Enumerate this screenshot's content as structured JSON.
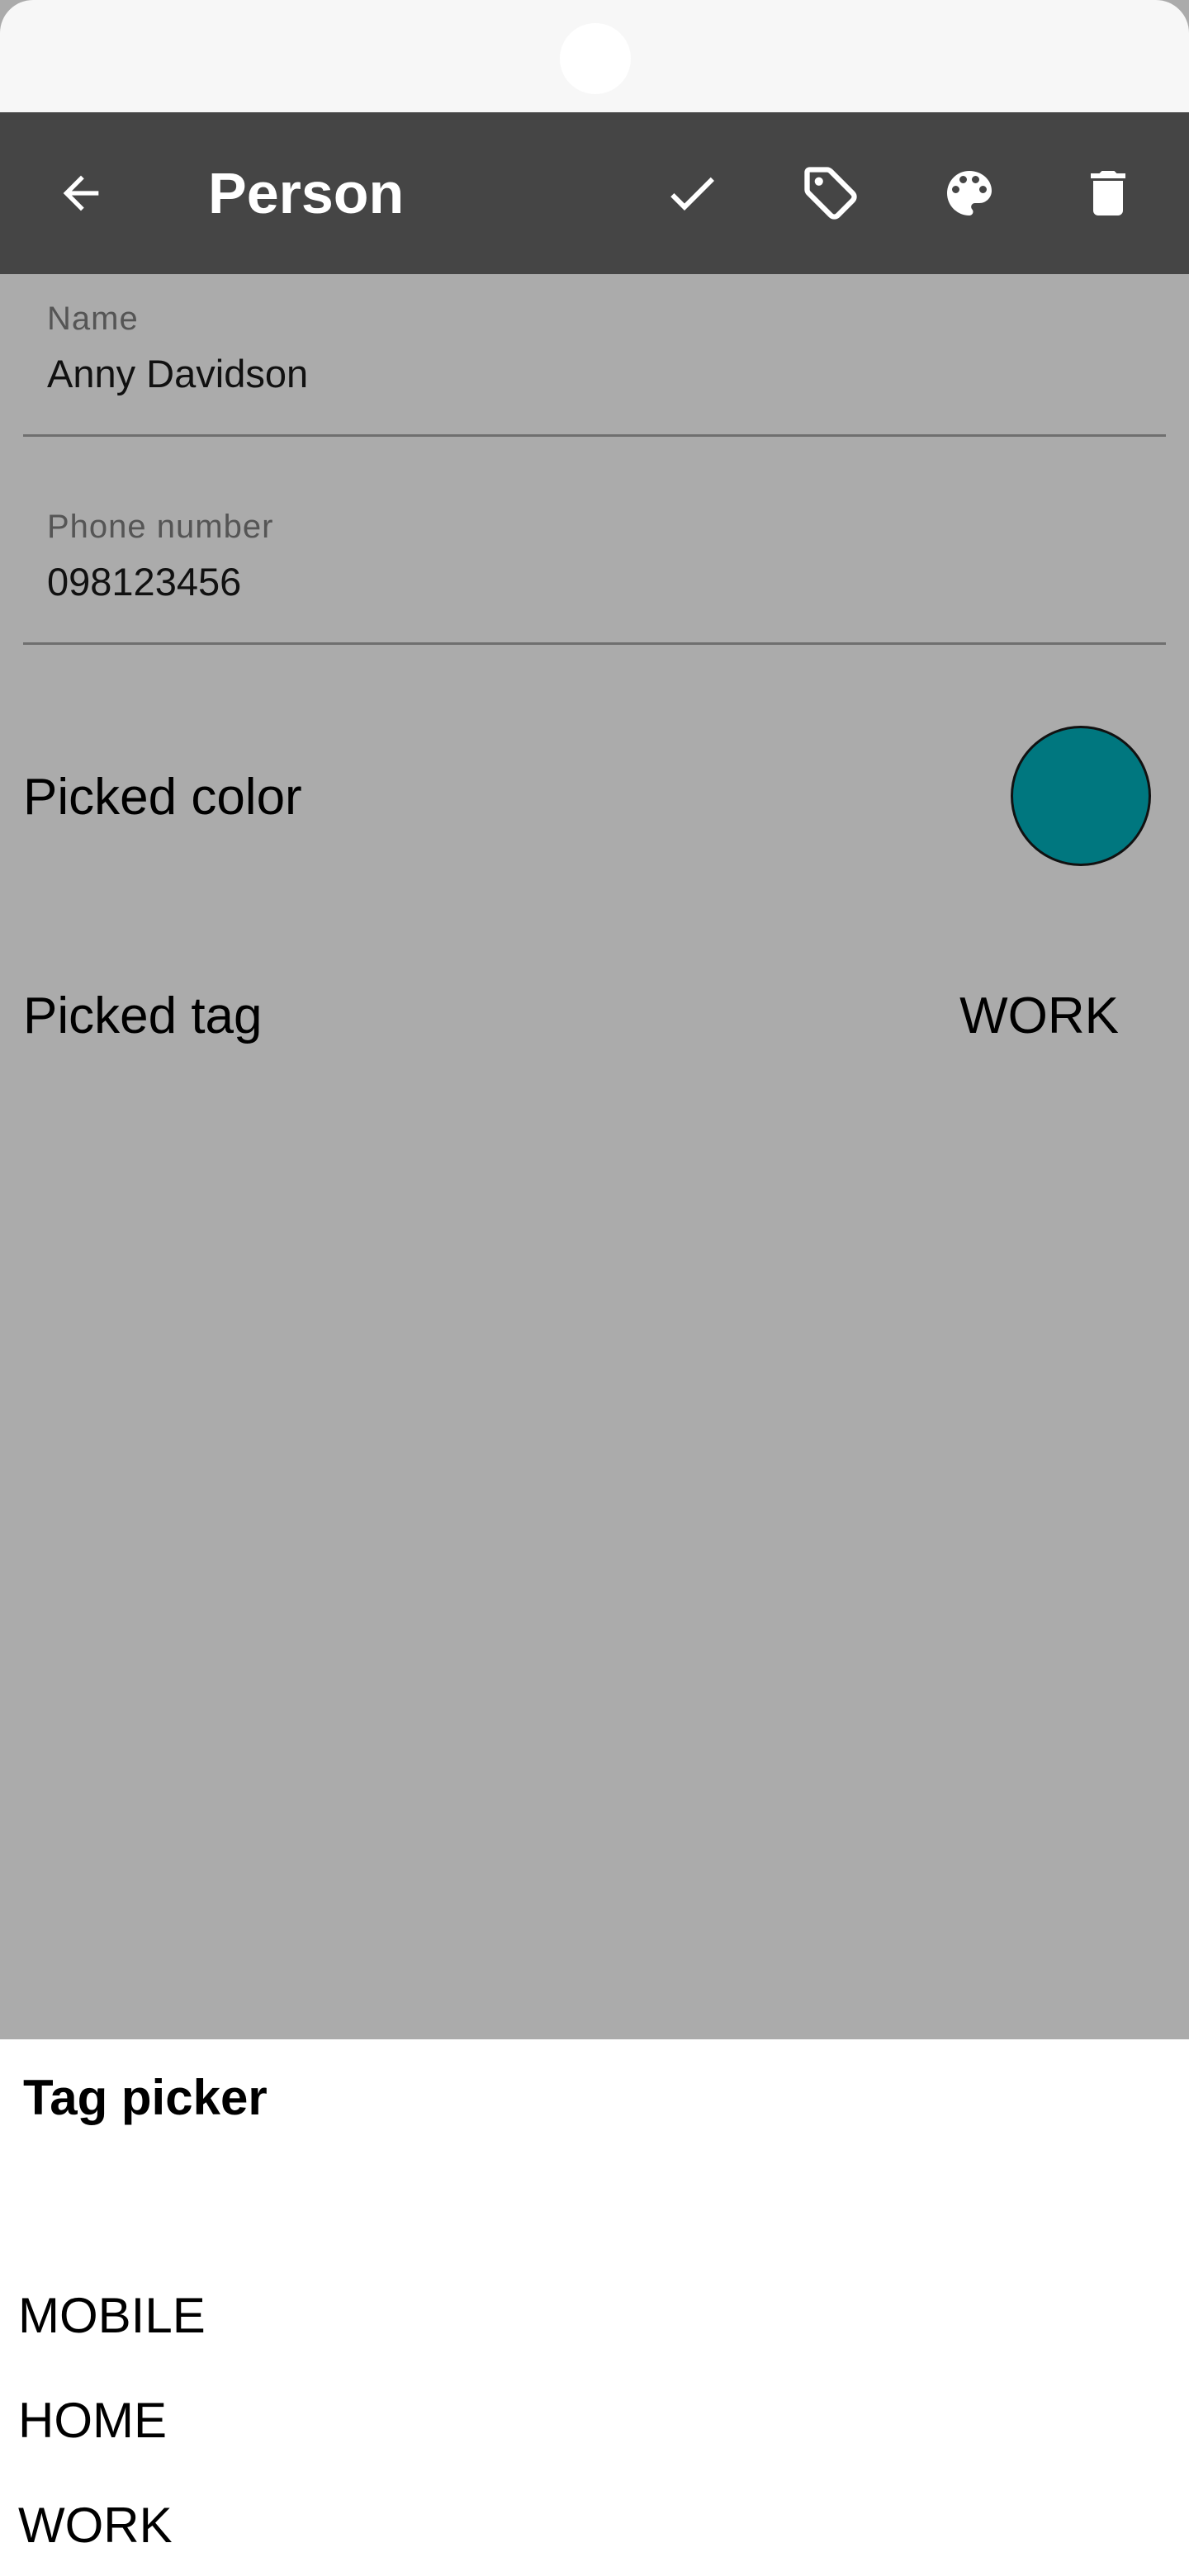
{
  "toolbar": {
    "title": "Person",
    "icons": [
      "back-arrow-icon",
      "check-icon",
      "tag-icon",
      "palette-icon",
      "trash-icon"
    ]
  },
  "form": {
    "name_label": "Name",
    "name_value": "Anny Davidson",
    "phone_label": "Phone number",
    "phone_value": "098123456",
    "color_label": "Picked color",
    "picked_color": "#00777f",
    "tag_label": "Picked tag",
    "tag_value": "WORK"
  },
  "tag_picker": {
    "title": "Tag picker",
    "options": [
      "MOBILE",
      "HOME",
      "WORK"
    ]
  },
  "colors": {
    "toolbar_bg": "#454545",
    "scrim_bg": "#ababab",
    "sheet_bg": "#ffffff"
  }
}
